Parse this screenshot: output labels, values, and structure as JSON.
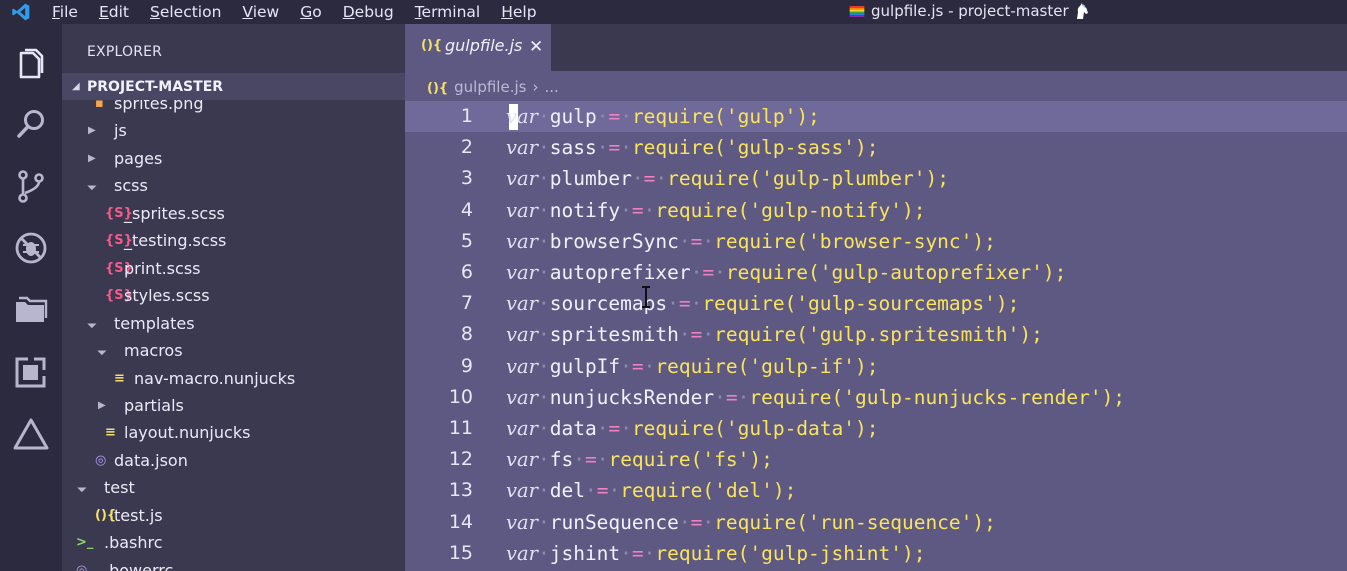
{
  "titlebar": {
    "menu": [
      {
        "mn": "F",
        "rest": "ile"
      },
      {
        "mn": "E",
        "rest": "dit"
      },
      {
        "mn": "S",
        "rest": "election"
      },
      {
        "mn": "V",
        "rest": "iew"
      },
      {
        "mn": "G",
        "rest": "o"
      },
      {
        "mn": "D",
        "rest": "ebug"
      },
      {
        "mn": "T",
        "rest": "erminal"
      },
      {
        "mn": "H",
        "rest": "elp"
      }
    ],
    "window_title": "gulpfile.js - project-master",
    "logo_icon": "vscode-logo-icon",
    "title_icons": [
      "rainbow-flag-icon",
      "unicorn-icon"
    ]
  },
  "activity_bar": {
    "icons": [
      "files-icon",
      "search-icon",
      "source-control-icon",
      "debug-icon",
      "folders-icon",
      "extensions-icon",
      "triangle-icon"
    ]
  },
  "sidebar": {
    "title": "EXPLORER",
    "project": "PROJECT-MASTER",
    "tree": [
      {
        "name": "sprites.png",
        "indent": 2,
        "kind": "png",
        "partial": true
      },
      {
        "name": "js",
        "indent": 2,
        "kind": "folder-closed"
      },
      {
        "name": "pages",
        "indent": 2,
        "kind": "folder-closed"
      },
      {
        "name": "scss",
        "indent": 2,
        "kind": "folder-open"
      },
      {
        "name": "_sprites.scss",
        "indent": 3,
        "kind": "scss"
      },
      {
        "name": "_testing.scss",
        "indent": 3,
        "kind": "scss"
      },
      {
        "name": "print.scss",
        "indent": 3,
        "kind": "scss"
      },
      {
        "name": "styles.scss",
        "indent": 3,
        "kind": "scss"
      },
      {
        "name": "templates",
        "indent": 2,
        "kind": "folder-open"
      },
      {
        "name": "macros",
        "indent": 3,
        "kind": "folder-open"
      },
      {
        "name": "nav-macro.nunjucks",
        "indent": 4,
        "kind": "nunjucks"
      },
      {
        "name": "partials",
        "indent": 3,
        "kind": "folder-closed"
      },
      {
        "name": "layout.nunjucks",
        "indent": 3,
        "kind": "nunjucks"
      },
      {
        "name": "data.json",
        "indent": 2,
        "kind": "json"
      },
      {
        "name": "test",
        "indent": 1,
        "kind": "folder-open"
      },
      {
        "name": "test.js",
        "indent": 2,
        "kind": "js"
      },
      {
        "name": ".bashrc",
        "indent": 1,
        "kind": "shell"
      },
      {
        "name": ".bowerrc",
        "indent": 1,
        "kind": "json",
        "partial": true
      }
    ],
    "icon_glyphs": {
      "scss": "{S}",
      "js": "(){",
      "json": "◎",
      "nunjucks": "≡",
      "shell": ">_",
      "png": "▪"
    },
    "icon_colors": {
      "scss": "#f55a8a",
      "js": "#f4e06a",
      "json": "#b49cf0",
      "nunjucks": "#f4e06a",
      "shell": "#8dd46a",
      "png": "#f4a84a"
    }
  },
  "editor": {
    "tab": {
      "label": "gulpfile.js",
      "icon": "js-file-icon",
      "close_glyph": "✕"
    },
    "breadcrumb": {
      "file": "gulpfile.js",
      "sep": "›",
      "rest": "..."
    },
    "current_line": 1,
    "lines": [
      {
        "n": "1",
        "name": "gulp",
        "mod": "gulp"
      },
      {
        "n": "2",
        "name": "sass",
        "mod": "gulp-sass"
      },
      {
        "n": "3",
        "name": "plumber",
        "mod": "gulp-plumber"
      },
      {
        "n": "4",
        "name": "notify",
        "mod": "gulp-notify"
      },
      {
        "n": "5",
        "name": "browserSync",
        "mod": "browser-sync"
      },
      {
        "n": "6",
        "name": "autoprefixer",
        "mod": "gulp-autoprefixer"
      },
      {
        "n": "7",
        "name": "sourcemaps",
        "mod": "gulp-sourcemaps"
      },
      {
        "n": "8",
        "name": "spritesmith",
        "mod": "gulp.spritesmith"
      },
      {
        "n": "9",
        "name": "gulpIf",
        "mod": "gulp-if"
      },
      {
        "n": "10",
        "name": "nunjucksRender",
        "mod": "gulp-nunjucks-render"
      },
      {
        "n": "11",
        "name": "data",
        "mod": "gulp-data"
      },
      {
        "n": "12",
        "name": "fs",
        "mod": "fs"
      },
      {
        "n": "13",
        "name": "del",
        "mod": "del"
      },
      {
        "n": "14",
        "name": "runSequence",
        "mod": "run-sequence"
      },
      {
        "n": "15",
        "name": "jshint",
        "mod": "gulp-jshint"
      }
    ],
    "tokens": {
      "kw": "var",
      "eq": "=",
      "fn": "require",
      "open": "('",
      "close": "');"
    }
  },
  "colors": {
    "titlebar_bg": "#2c2a3f",
    "sidebar_bg": "#3b3950",
    "editor_bg": "#5e5983",
    "current_line_bg": "#6f6a99",
    "string_yellow": "#f9e45b",
    "operator_pink": "#f080c0"
  }
}
